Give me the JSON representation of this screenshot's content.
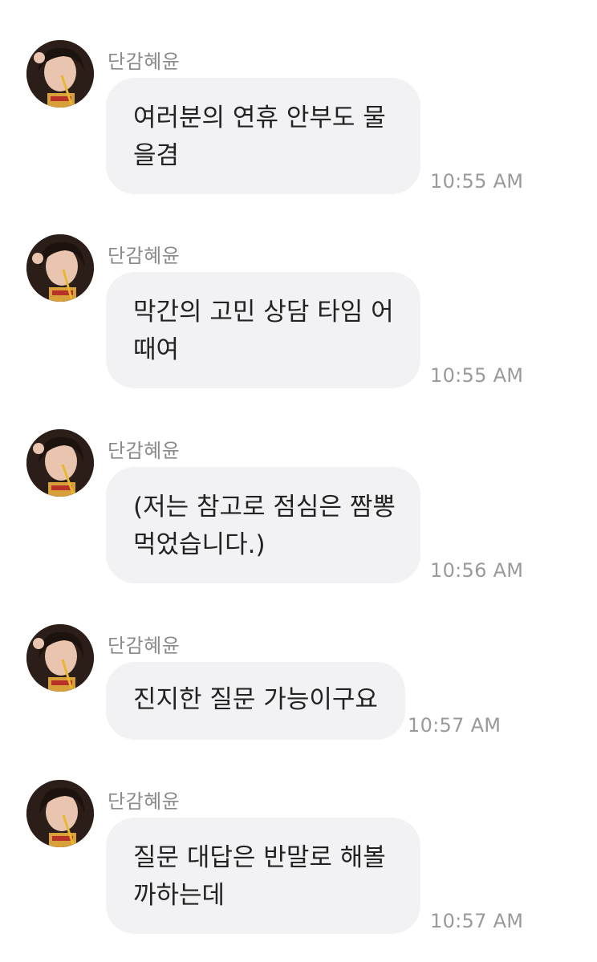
{
  "messages": [
    {
      "sender": "단감혜윤",
      "lines": [
        "여러분의 연휴 안부도 물",
        "을겸"
      ],
      "time": "10:55 AM"
    },
    {
      "sender": "단감혜윤",
      "lines": [
        "막간의 고민 상담 타임 어",
        "때여"
      ],
      "time": "10:55 AM"
    },
    {
      "sender": "단감혜윤",
      "lines": [
        "(저는 참고로 점심은 짬뽕",
        "먹었습니다.)"
      ],
      "time": "10:56 AM"
    },
    {
      "sender": "단감혜윤",
      "lines": [
        "진지한 질문 가능이구요"
      ],
      "time": "10:57 AM"
    },
    {
      "sender": "단감혜윤",
      "lines": [
        "질문 대답은 반말로 해볼",
        "까하는데"
      ],
      "time": "10:57 AM"
    }
  ],
  "colors": {
    "bubble": "#f2f2f4",
    "text": "#222222",
    "sender": "#8a8a8a",
    "time": "#9a9a9a"
  },
  "icons": {
    "avatar": "profile-photo"
  }
}
